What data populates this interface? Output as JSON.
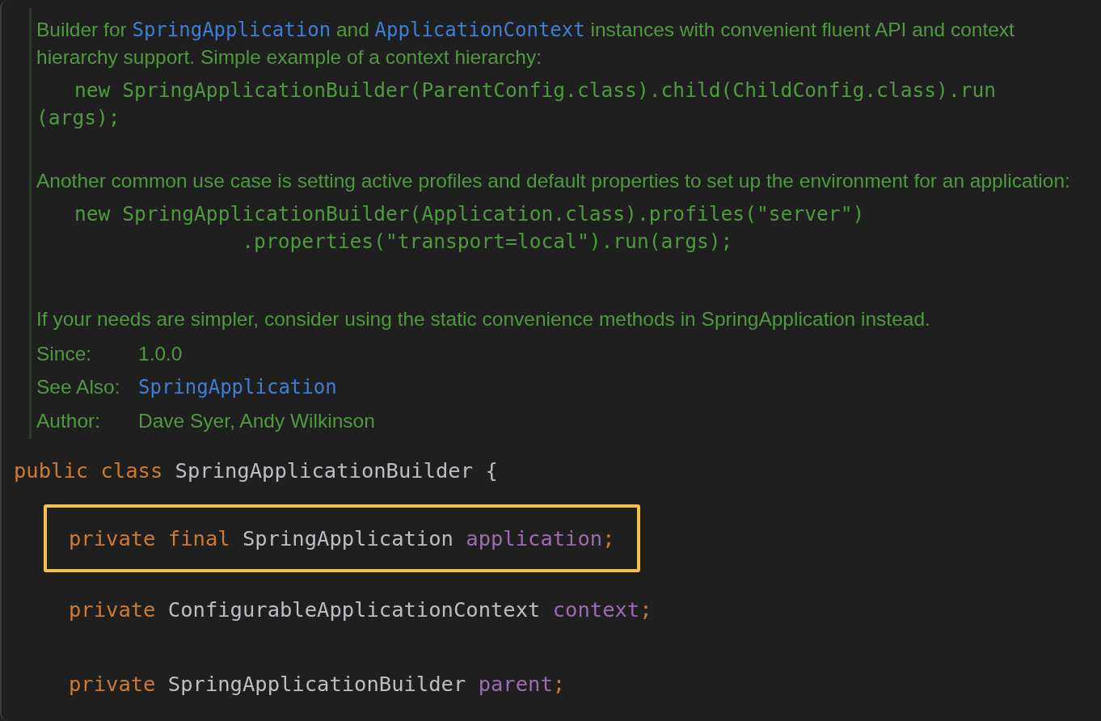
{
  "doc": {
    "blocks": [
      {
        "kind": "paragraph",
        "segments": [
          {
            "kind": "text",
            "text": "Builder for "
          },
          {
            "kind": "link",
            "text": "SpringApplication"
          },
          {
            "kind": "text",
            "text": " and "
          },
          {
            "kind": "link",
            "text": "ApplicationContext"
          },
          {
            "kind": "text",
            "text": " instances with convenient fluent API and context hierarchy support. Simple example of a context hierarchy:"
          }
        ]
      },
      {
        "kind": "code",
        "lines": [
          {
            "kind": "line",
            "text": "new SpringApplicationBuilder(ParentConfig.class).child(ChildConfig.class).run"
          },
          {
            "kind": "continuation",
            "text": "(args);"
          }
        ]
      },
      {
        "kind": "paragraph",
        "segments": [
          {
            "kind": "text",
            "text": "Another common use case is setting active profiles and default properties to set up the environment for an application:"
          }
        ]
      },
      {
        "kind": "code",
        "lines": [
          {
            "kind": "line",
            "text": "new SpringApplicationBuilder(Application.class).profiles(\"server\")"
          },
          {
            "kind": "line",
            "text": "              .properties(\"transport=local\").run(args);"
          }
        ]
      },
      {
        "kind": "paragraph",
        "segments": [
          {
            "kind": "text",
            "text": "If your needs are simpler, consider using the static convenience methods in SpringApplication instead."
          }
        ]
      }
    ],
    "tags": [
      {
        "label": "Since:",
        "value": {
          "kind": "text",
          "text": "1.0.0"
        }
      },
      {
        "label": "See Also:",
        "value": {
          "kind": "link",
          "text": "SpringApplication"
        }
      },
      {
        "label": "Author:",
        "value": {
          "kind": "text",
          "text": "Dave Syer, Andy Wilkinson"
        }
      }
    ]
  },
  "code": {
    "lines": [
      {
        "indented": false,
        "highlighted": false,
        "tokens": [
          {
            "kind": "keyword",
            "text": "public class "
          },
          {
            "kind": "type",
            "text": "SpringApplicationBuilder {"
          }
        ]
      },
      {
        "indented": true,
        "highlighted": true,
        "tokens": [
          {
            "kind": "keyword",
            "text": "private final "
          },
          {
            "kind": "type",
            "text": "SpringApplication "
          },
          {
            "kind": "field",
            "text": "application"
          },
          {
            "kind": "keyword",
            "text": ";"
          }
        ]
      },
      {
        "indented": true,
        "highlighted": false,
        "tokens": [
          {
            "kind": "keyword",
            "text": "private "
          },
          {
            "kind": "type",
            "text": "ConfigurableApplicationContext "
          },
          {
            "kind": "field",
            "text": "context"
          },
          {
            "kind": "keyword",
            "text": ";"
          }
        ]
      },
      {
        "indented": true,
        "highlighted": false,
        "tokens": [
          {
            "kind": "keyword",
            "text": "private "
          },
          {
            "kind": "type",
            "text": "SpringApplicationBuilder "
          },
          {
            "kind": "field",
            "text": "parent"
          },
          {
            "kind": "keyword",
            "text": ";"
          }
        ]
      }
    ]
  }
}
